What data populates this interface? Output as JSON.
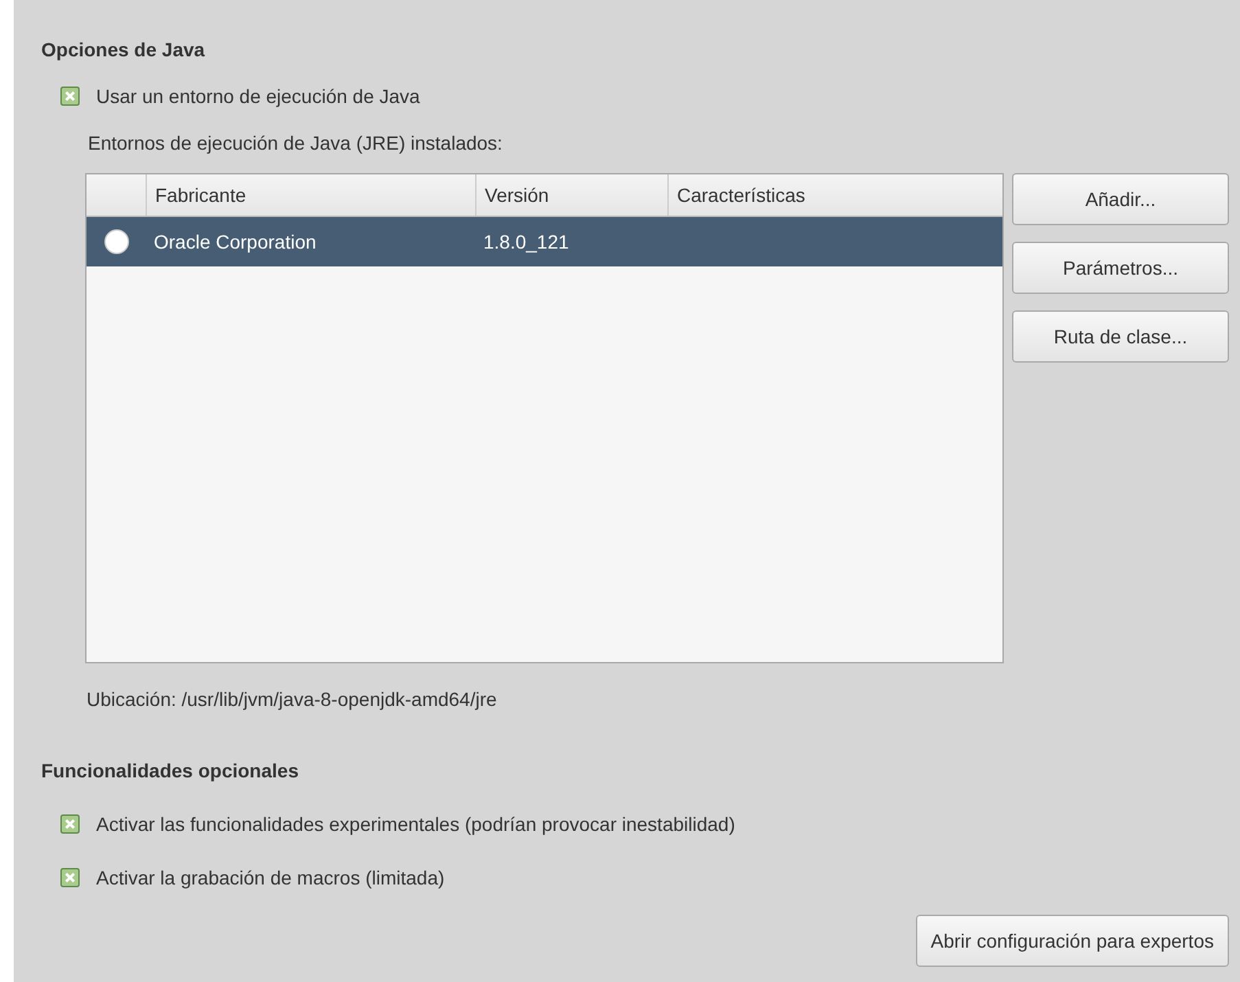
{
  "java_options": {
    "title": "Opciones de Java",
    "use_jre": {
      "label": "Usar un entorno de ejecución de Java",
      "checked": true
    },
    "installed_label": "Entornos de ejecución de Java (JRE) instalados:",
    "table": {
      "columns": [
        "Fabricante",
        "Versión",
        "Características"
      ],
      "rows": [
        {
          "vendor": "Oracle Corporation",
          "version": "1.8.0_121",
          "features": "",
          "checked": false,
          "selected": true
        }
      ]
    },
    "buttons": [
      "Añadir...",
      "Parámetros...",
      "Ruta de clase..."
    ],
    "location": "Ubicación: /usr/lib/jvm/java-8-openjdk-amd64/jre"
  },
  "optional_features": {
    "title": "Funcionalidades opcionales",
    "options": [
      {
        "label": "Activar las funcionalidades experimentales (podrían provocar inestabilidad)",
        "checked": true
      },
      {
        "label": "Activar la grabación de macros (limitada)",
        "checked": true
      }
    ],
    "expert_button": "Abrir configuración para expertos"
  }
}
